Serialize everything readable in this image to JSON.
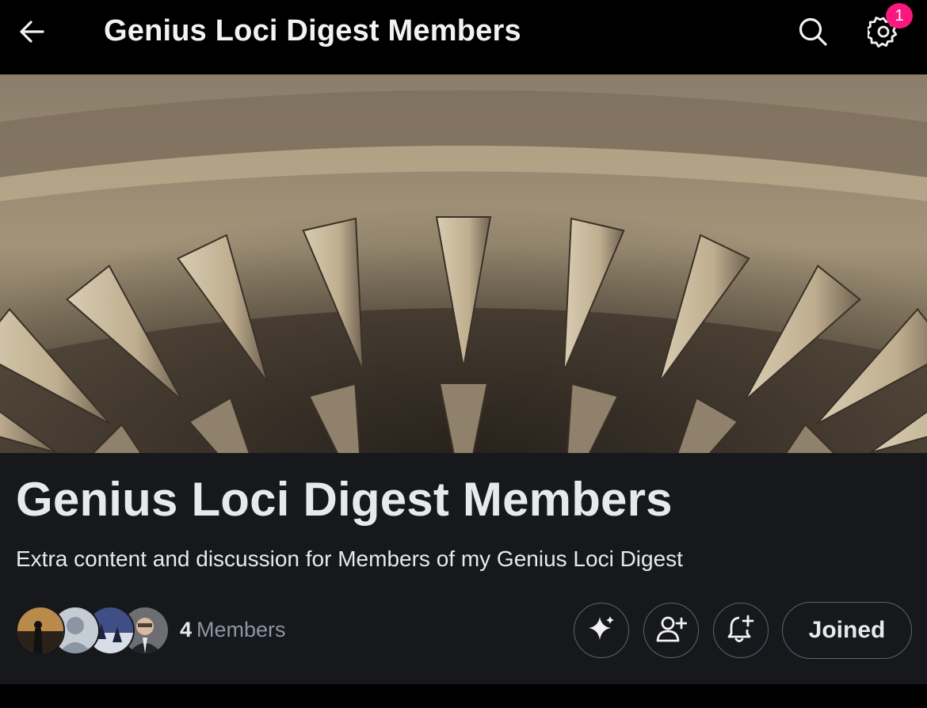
{
  "header": {
    "title": "Genius Loci Digest Members",
    "back_icon": "arrow-left-icon",
    "search_icon": "search-icon",
    "settings_icon": "gear-icon",
    "notification_badge": "1"
  },
  "banner": {
    "image": "carved-stone-arch-banner"
  },
  "community": {
    "name": "Genius Loci Digest Members",
    "description": "Extra content and discussion for Members of my Genius Loci Digest",
    "member_count": "4",
    "member_label": "Members",
    "avatars": [
      "member-avatar-1",
      "member-avatar-2",
      "member-avatar-3",
      "member-avatar-4"
    ],
    "actions": {
      "grok_icon": "sparkle-icon",
      "invite_icon": "add-user-icon",
      "notify_icon": "bell-plus-icon",
      "joined_label": "Joined"
    }
  },
  "colors": {
    "background": "#000000",
    "panel": "#16181c",
    "text_primary": "#e7e9ea",
    "text_secondary": "#8b98a5",
    "badge": "#f91880",
    "button_border": "#596570"
  }
}
